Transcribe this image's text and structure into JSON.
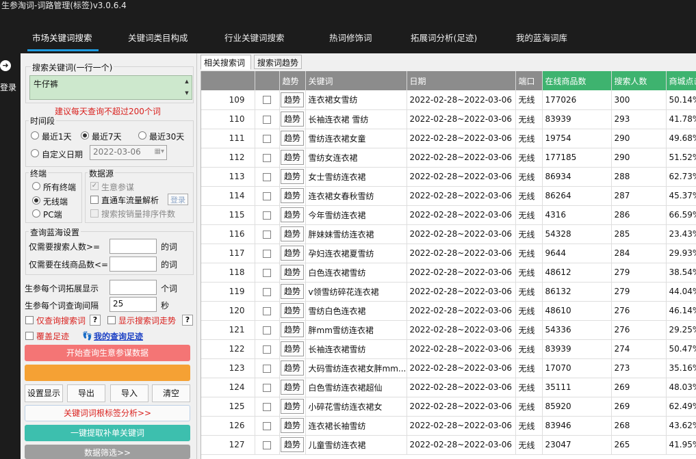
{
  "window": {
    "title": "生参淘词-词路管理(标签)v3.0.6.4"
  },
  "nav": {
    "items": [
      "市场关键词搜索",
      "关键词类目构成",
      "行业关键词搜索",
      "热词修饰词",
      "拓展词分析(足迹)",
      "我的蓝海词库"
    ],
    "active_index": 0,
    "accent_color": "#1e9be0"
  },
  "sidebar": {
    "login_label": "登录"
  },
  "panel": {
    "search_group_label": "搜索关键词(一行一个)",
    "search_value": "牛仔裤",
    "warning": "建议每天查询不超过200个词",
    "period_label": "时间段",
    "periods": [
      "最近1天",
      "最近7天",
      "最近30天",
      "自定义日期"
    ],
    "period_selected": "最近7天",
    "custom_date": "2022-03-06",
    "terminal_label": "终端",
    "terminals": [
      "所有终端",
      "无线端",
      "PC端"
    ],
    "terminal_selected": "无线端",
    "source_label": "数据源",
    "sources": [
      "生意参谋",
      "直通车流量解析",
      "搜索按销量排序件数"
    ],
    "login_small": "登录",
    "bluesea_label": "查询蓝海设置",
    "min_search_label": "仅需要搜索人数>=",
    "max_goods_label": "仅需要在线商品数<=",
    "suffix_word": "的词",
    "expand_label": "生参每个词拓展显示",
    "expand_suffix": "个词",
    "interval_label": "生参每个词查询间隔",
    "interval_value": "25",
    "interval_suffix": "秒",
    "only_query_label": "仅查询搜索词",
    "show_trend_label": "显示搜索词走势",
    "help": "?",
    "cover_footprint_label": "覆盖足迹",
    "my_footprint_link": "我的查询足迹",
    "start_button": "开始查询生意参谋数据",
    "settings_button": "设置显示",
    "export_button": "导出",
    "import_button": "导入",
    "clear_button": "清空",
    "root_tag_button": "关键词词根标签分析>>",
    "extract_button": "一键提取补单关键词",
    "filter_button": "数据筛选>>",
    "button_colors": {
      "start": "#f47575",
      "second": "#f5a134",
      "extract": "#3dbfae",
      "filter": "#9e9e9e"
    }
  },
  "tabs": [
    "相关搜索词",
    "搜索词趋势"
  ],
  "table": {
    "columns": [
      "",
      "",
      "趋势",
      "关键词",
      "日期",
      "端口",
      "在线商品数",
      "搜索人数",
      "商城点击"
    ],
    "trend_label": "趋势",
    "header_green_color": "#3eb36f",
    "rows": [
      {
        "n": "109",
        "kw": "连衣裙女雪纺",
        "date": "2022-02-28~2022-03-06",
        "port": "无线",
        "goods": "177026",
        "search": "300",
        "mall": "50.14%"
      },
      {
        "n": "110",
        "kw": "长袖连衣裙 雪纺",
        "date": "2022-02-28~2022-03-06",
        "port": "无线",
        "goods": "83939",
        "search": "293",
        "mall": "41.78%"
      },
      {
        "n": "111",
        "kw": "雪纺连衣裙女童",
        "date": "2022-02-28~2022-03-06",
        "port": "无线",
        "goods": "19754",
        "search": "290",
        "mall": "49.68%"
      },
      {
        "n": "112",
        "kw": "雪纺女连衣裙",
        "date": "2022-02-28~2022-03-06",
        "port": "无线",
        "goods": "177185",
        "search": "290",
        "mall": "51.52%"
      },
      {
        "n": "113",
        "kw": "女士雪纺连衣裙",
        "date": "2022-02-28~2022-03-06",
        "port": "无线",
        "goods": "86934",
        "search": "288",
        "mall": "62.73%"
      },
      {
        "n": "114",
        "kw": "连衣裙女春秋雪纺",
        "date": "2022-02-28~2022-03-06",
        "port": "无线",
        "goods": "86264",
        "search": "287",
        "mall": "45.37%"
      },
      {
        "n": "115",
        "kw": "今年雪纺连衣裙",
        "date": "2022-02-28~2022-03-06",
        "port": "无线",
        "goods": "4316",
        "search": "286",
        "mall": "66.59%"
      },
      {
        "n": "116",
        "kw": "胖妹妹雪纺连衣裙",
        "date": "2022-02-28~2022-03-06",
        "port": "无线",
        "goods": "54328",
        "search": "285",
        "mall": "23.43%"
      },
      {
        "n": "117",
        "kw": "孕妇连衣裙夏雪纺",
        "date": "2022-02-28~2022-03-06",
        "port": "无线",
        "goods": "9644",
        "search": "284",
        "mall": "29.93%"
      },
      {
        "n": "118",
        "kw": "白色连衣裙雪纺",
        "date": "2022-02-28~2022-03-06",
        "port": "无线",
        "goods": "48612",
        "search": "279",
        "mall": "38.54%"
      },
      {
        "n": "119",
        "kw": "v领雪纺碎花连衣裙",
        "date": "2022-02-28~2022-03-06",
        "port": "无线",
        "goods": "86132",
        "search": "279",
        "mall": "44.04%"
      },
      {
        "n": "120",
        "kw": "雪纺白色连衣裙",
        "date": "2022-02-28~2022-03-06",
        "port": "无线",
        "goods": "48610",
        "search": "276",
        "mall": "46.14%"
      },
      {
        "n": "121",
        "kw": "胖mm雪纺连衣裙",
        "date": "2022-02-28~2022-03-06",
        "port": "无线",
        "goods": "54336",
        "search": "276",
        "mall": "29.25%"
      },
      {
        "n": "122",
        "kw": "长袖连衣裙雪纺",
        "date": "2022-02-28~2022-03-06",
        "port": "无线",
        "goods": "83939",
        "search": "274",
        "mall": "50.47%"
      },
      {
        "n": "123",
        "kw": "大码雪纺连衣裙女胖mm...",
        "date": "2022-02-28~2022-03-06",
        "port": "无线",
        "goods": "17070",
        "search": "273",
        "mall": "35.16%"
      },
      {
        "n": "124",
        "kw": "白色雪纺连衣裙超仙",
        "date": "2022-02-28~2022-03-06",
        "port": "无线",
        "goods": "35111",
        "search": "269",
        "mall": "48.03%"
      },
      {
        "n": "125",
        "kw": "小碎花雪纺连衣裙女",
        "date": "2022-02-28~2022-03-06",
        "port": "无线",
        "goods": "85920",
        "search": "269",
        "mall": "62.49%"
      },
      {
        "n": "126",
        "kw": "连衣裙长袖雪纺",
        "date": "2022-02-28~2022-03-06",
        "port": "无线",
        "goods": "83946",
        "search": "268",
        "mall": "43.62%"
      },
      {
        "n": "127",
        "kw": "儿童雪纺连衣裙",
        "date": "2022-02-28~2022-03-06",
        "port": "无线",
        "goods": "23047",
        "search": "265",
        "mall": "41.95%"
      }
    ]
  }
}
